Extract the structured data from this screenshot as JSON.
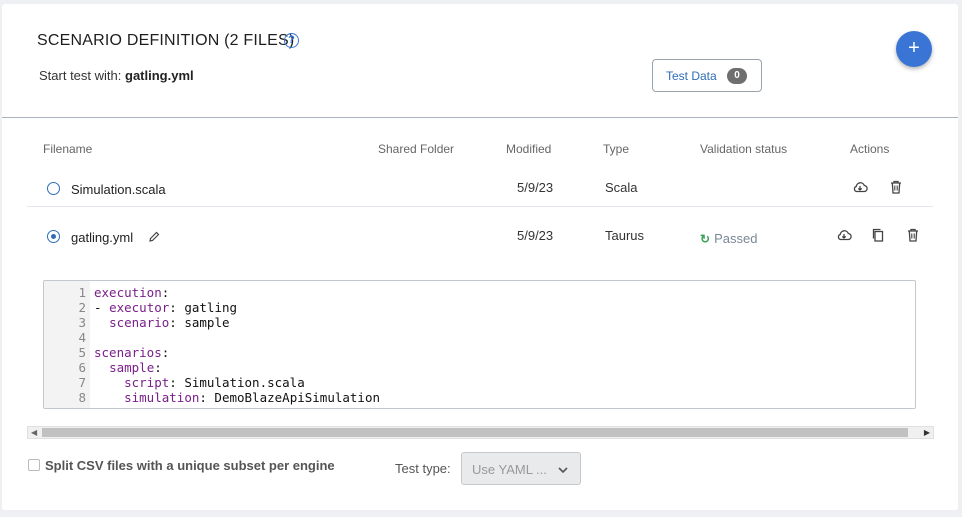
{
  "header": {
    "title": "SCENARIO DEFINITION (2 FILES)",
    "help_icon": "question-circle-icon",
    "start_prefix": "Start test with:",
    "start_file": "gatling.yml",
    "test_data_label": "Test Data",
    "test_data_count": "0",
    "add_button_label": "+"
  },
  "table": {
    "headers": {
      "filename": "Filename",
      "shared_folder": "Shared Folder",
      "modified": "Modified",
      "type": "Type",
      "validation": "Validation status",
      "actions": "Actions"
    },
    "rows": [
      {
        "filename": "Simulation.scala",
        "modified": "5/9/23",
        "type": "Scala",
        "status": "",
        "selected": false
      },
      {
        "filename": "gatling.yml",
        "modified": "5/9/23",
        "type": "Taurus",
        "status": "Passed",
        "status_icon": "↻",
        "selected": true
      }
    ]
  },
  "editor": {
    "lines": [
      {
        "n": "1",
        "key": "execution",
        "rest": ""
      },
      {
        "n": "2",
        "pre": "- ",
        "key": "executor",
        "rest": " gatling"
      },
      {
        "n": "3",
        "pre": "  ",
        "key": "scenario",
        "rest": " sample"
      },
      {
        "n": "4",
        "pre": "",
        "key": "",
        "rest": ""
      },
      {
        "n": "5",
        "key": "scenarios",
        "rest": ""
      },
      {
        "n": "6",
        "pre": "  ",
        "key": "sample",
        "rest": ""
      },
      {
        "n": "7",
        "pre": "    ",
        "key": "script",
        "rest": " Simulation.scala"
      },
      {
        "n": "8",
        "pre": "    ",
        "key": "simulation",
        "rest": " DemoBlazeApiSimulation"
      }
    ]
  },
  "footer": {
    "split_csv_label": "Split CSV files with a unique subset per engine",
    "test_type_label": "Test type:",
    "test_type_value": "Use YAML ..."
  },
  "colors": {
    "accent": "#3a75d6",
    "passed": "#3aa15a"
  }
}
